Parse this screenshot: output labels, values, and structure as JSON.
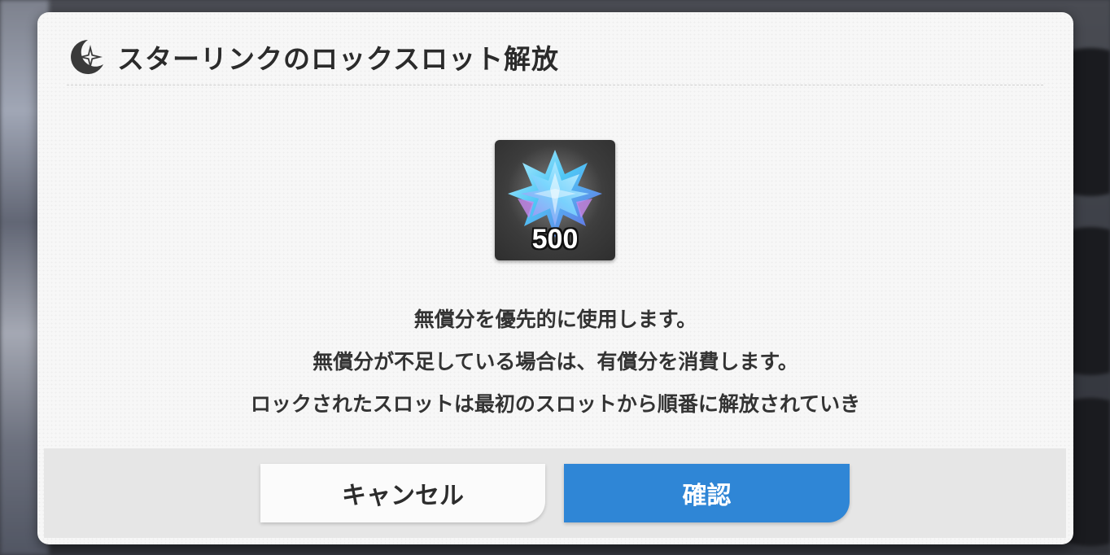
{
  "dialog": {
    "title": "スターリンクのロックスロット解放",
    "title_icon": "starlink-icon",
    "item": {
      "icon": "crystal-icon",
      "count": "500"
    },
    "message_lines": [
      "無償分を優先的に使用します。",
      "無償分が不足している場合は、有償分を消費します。",
      "ロックされたスロットは最初のスロットから順番に解放されていき"
    ],
    "cancel_label": "キャンセル",
    "confirm_label": "確認"
  },
  "colors": {
    "confirm_button": "#2f86d6",
    "dialog_bg": "#f7f7f7",
    "footer_bg": "#e6e6e6"
  }
}
